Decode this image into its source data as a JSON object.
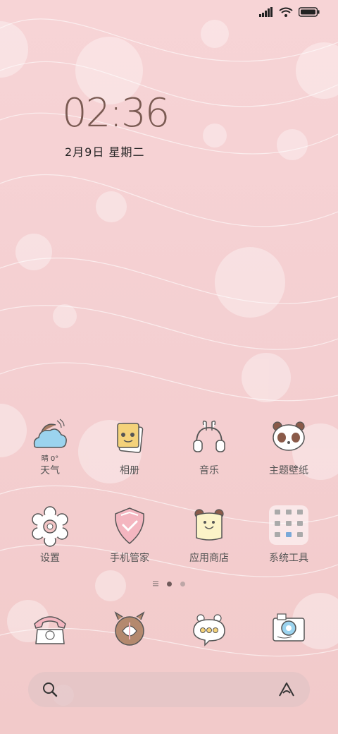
{
  "clock": {
    "time": "02:36",
    "date": "2月9日  星期二"
  },
  "apps_row1": [
    {
      "label": "天气",
      "icon": "cloud-icon",
      "temp": "晴 0°"
    },
    {
      "label": "相册",
      "icon": "gallery-icon"
    },
    {
      "label": "音乐",
      "icon": "headphones-icon"
    },
    {
      "label": "主题壁纸",
      "icon": "panda-icon"
    }
  ],
  "apps_row2": [
    {
      "label": "设置",
      "icon": "gear-icon"
    },
    {
      "label": "手机管家",
      "icon": "shield-icon"
    },
    {
      "label": "应用商店",
      "icon": "store-icon"
    },
    {
      "label": "系统工具",
      "icon": "tools-folder-icon"
    }
  ],
  "dock": [
    {
      "icon": "phone-icon"
    },
    {
      "icon": "browser-icon"
    },
    {
      "icon": "messages-icon"
    },
    {
      "icon": "camera-icon"
    }
  ],
  "colors": {
    "bg": "#f6d2d4",
    "accent": "#7a5a52"
  }
}
